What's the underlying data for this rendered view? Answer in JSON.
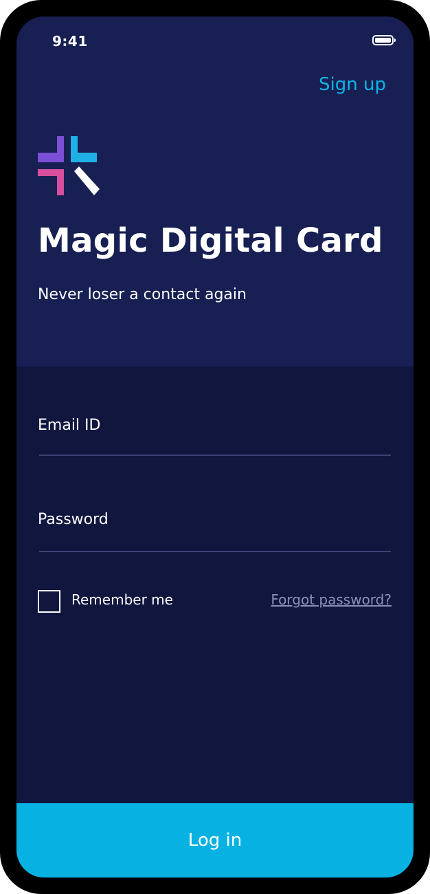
{
  "status_bar": {
    "time": "9:41"
  },
  "header": {
    "signup_label": "Sign up"
  },
  "brand": {
    "title": "Magic Digital Card",
    "tagline": "Never loser a contact again"
  },
  "form": {
    "email_label": "Email ID",
    "password_label": "Password",
    "remember_label": "Remember me",
    "remember_checked": false,
    "forgot_label": "Forgot password?"
  },
  "footer": {
    "login_label": "Log in"
  },
  "colors": {
    "hero_background": "#171f53",
    "form_background": "#11163f",
    "accent": "#07b1e2",
    "logo_purple": "#7b4fd6",
    "logo_pink": "#d84f9e",
    "logo_blue": "#1fb0e6",
    "logo_white": "#ffffff"
  },
  "icons": [
    "battery-icon",
    "app-logo-icon",
    "checkbox-icon"
  ]
}
